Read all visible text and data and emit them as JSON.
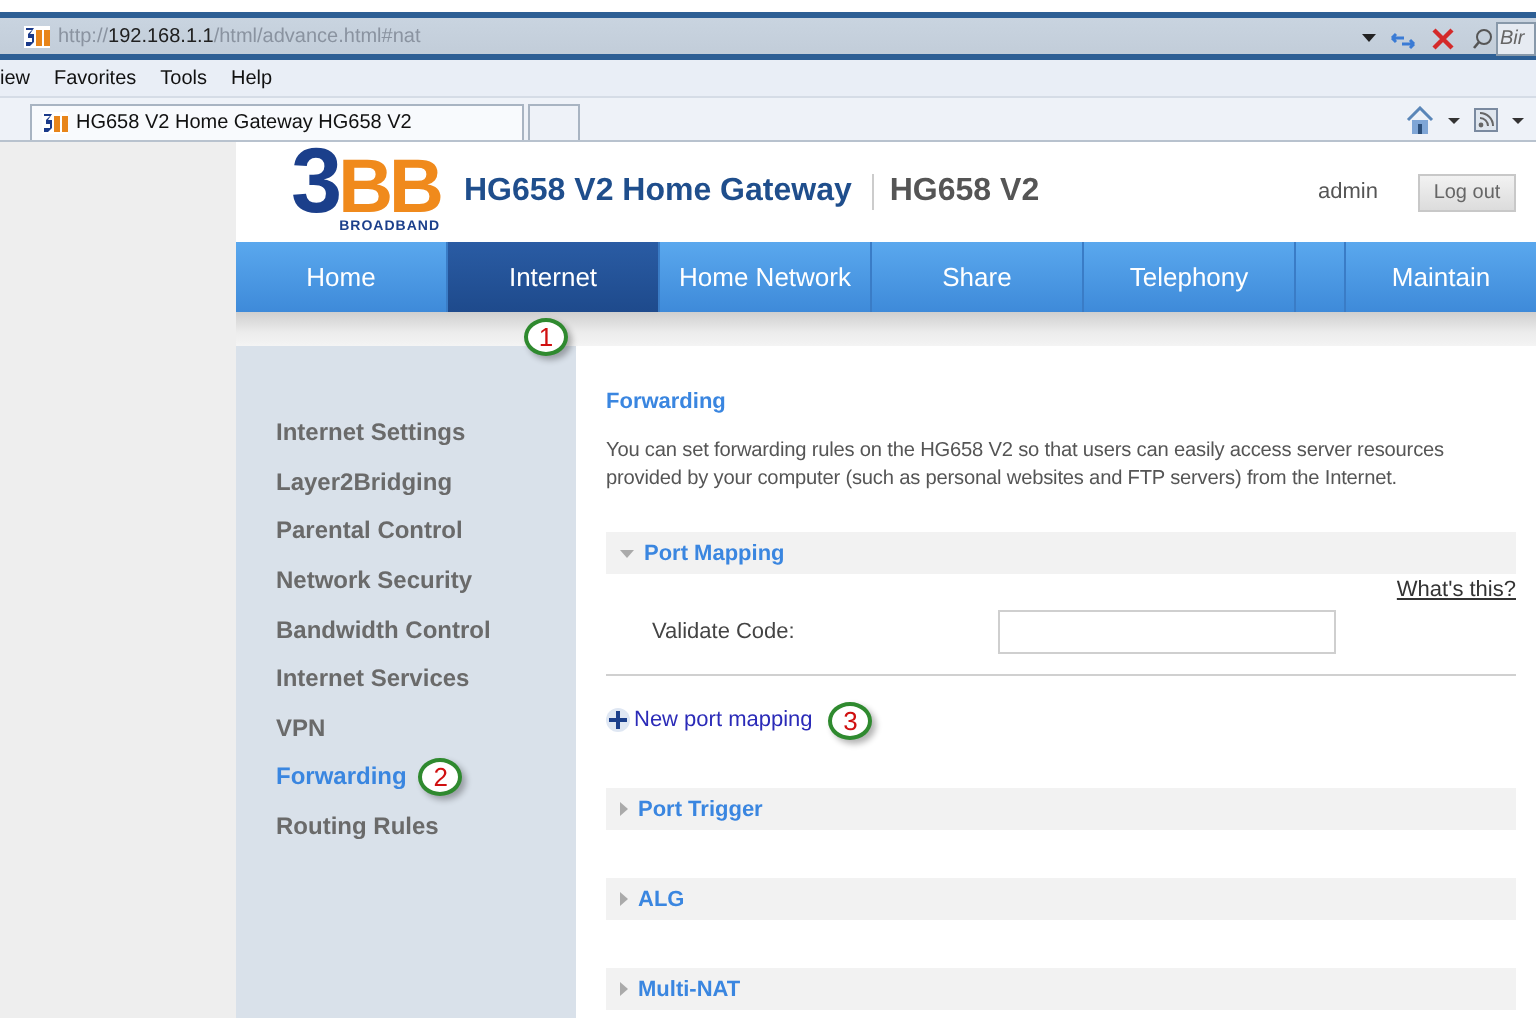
{
  "browser": {
    "address": "http://**192.168.1.1**/html/advance.html#nat",
    "search_placeholder": "Bir",
    "menu": [
      "iew",
      "Favorites",
      "Tools",
      "Help"
    ],
    "tabs": [
      {
        "title": "HG658 V2 Home Gateway HG658 V2",
        "selected": true
      }
    ]
  },
  "header": {
    "logo": [
      "3",
      "BB"
    ],
    "logo_tagline": "BROADBAND",
    "title": "HG658 V2 Home Gateway",
    "model": "HG658 V2",
    "user": "admin",
    "logout": "Log out"
  },
  "nav": [
    {
      "label": "Home",
      "selected": false
    },
    {
      "label": "Internet",
      "selected": true,
      "annotation": "1"
    },
    {
      "label": "Home Network",
      "selected": false
    },
    {
      "label": "Share",
      "selected": false
    },
    {
      "label": "Telephony",
      "selected": false
    },
    {
      "label": "Maintain",
      "selected": false
    }
  ],
  "sidebar": [
    {
      "label": "Internet Settings",
      "selected": false
    },
    {
      "label": "Layer2Bridging",
      "selected": false
    },
    {
      "label": "Parental Control",
      "selected": false
    },
    {
      "label": "Network Security",
      "selected": false
    },
    {
      "label": "Bandwidth Control",
      "selected": false
    },
    {
      "label": "Internet Services",
      "selected": false
    },
    {
      "label": "VPN",
      "selected": false
    },
    {
      "label": "Forwarding",
      "selected": true,
      "annotation": "2"
    },
    {
      "label": "Routing Rules",
      "selected": false
    }
  ],
  "content": {
    "title": "Forwarding",
    "description": "You can set forwarding rules on the HG658 V2 so that users can easily access server resources provided by your computer (such as personal websites and FTP servers) from the Internet.",
    "sections": [
      {
        "title": "Port Mapping",
        "expanded": true,
        "help_link": "What's this?",
        "fields": [
          {
            "label": "Validate Code:"
          }
        ],
        "add_link": "New port mapping",
        "add_annotation": "3"
      },
      {
        "title": "Port Trigger",
        "expanded": false
      },
      {
        "title": "ALG",
        "expanded": false
      },
      {
        "title": "Multi-NAT",
        "expanded": false
      }
    ]
  }
}
